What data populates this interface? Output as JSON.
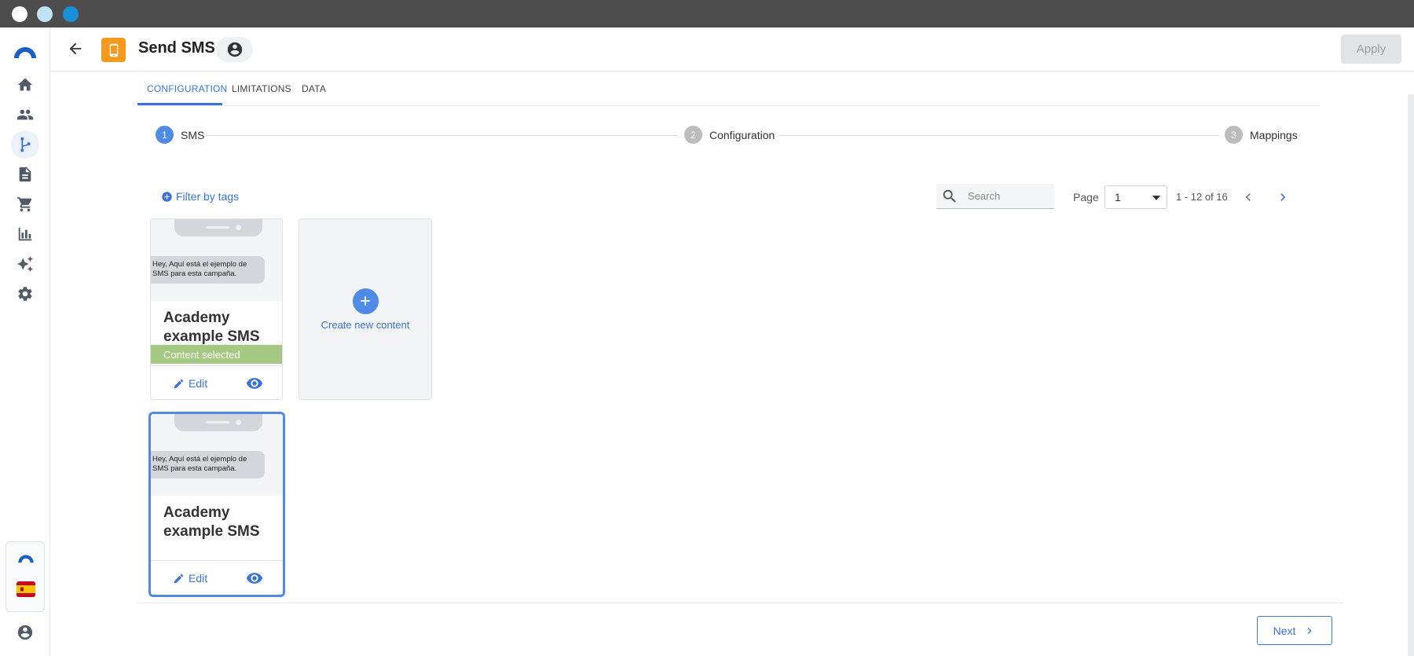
{
  "header": {
    "title": "Send SMS",
    "apply_label": "Apply"
  },
  "tabs": [
    {
      "label": "CONFIGURATION"
    },
    {
      "label": "LIMITATIONS"
    },
    {
      "label": "DATA"
    }
  ],
  "stepper": [
    {
      "num": "1",
      "label": "SMS"
    },
    {
      "num": "2",
      "label": "Configuration"
    },
    {
      "num": "3",
      "label": "Mappings"
    }
  ],
  "toolbar": {
    "filter_label": "Filter by tags",
    "search_placeholder": "Search",
    "page_label": "Page",
    "page_value": "1",
    "range_text": "1 - 12 of 16"
  },
  "cards": [
    {
      "preview_text": "Hey, Aquí está el ejemplo de SMS para esta campaña.",
      "title": "Academy example SMS",
      "badge": "Content selected",
      "edit_label": "Edit"
    },
    {
      "preview_text": "Hey, Aquí está el ejemplo de SMS para esta campaña.",
      "title": "Academy example SMS",
      "edit_label": "Edit"
    }
  ],
  "create_label": "Create new content",
  "footer": {
    "next_label": "Next"
  },
  "colors": {
    "accent": "#3b74d8",
    "app_icon": "#f7991c",
    "selected_badge": "#a5c882"
  },
  "icons": {
    "rail": [
      "home-icon",
      "people-icon",
      "flow-icon",
      "document-icon",
      "cart-icon",
      "bar-chart-icon",
      "sparkle-icon",
      "gear-icon"
    ]
  }
}
